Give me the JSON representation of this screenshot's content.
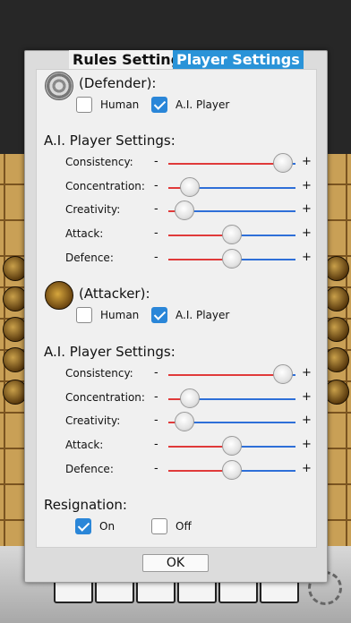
{
  "tabs": {
    "rules": "Rules Settings",
    "player": "Player Settings"
  },
  "defender": {
    "title": "(Defender):",
    "human_label": "Human",
    "ai_label": "A.I. Player",
    "human_checked": false,
    "ai_checked": true,
    "settings_title": "A.I. Player Settings:",
    "sliders": [
      {
        "label": "Consistency:",
        "value": 0.9
      },
      {
        "label": "Concentration:",
        "value": 0.17
      },
      {
        "label": "Creativity:",
        "value": 0.13
      },
      {
        "label": "Attack:",
        "value": 0.5
      },
      {
        "label": "Defence:",
        "value": 0.5
      }
    ]
  },
  "attacker": {
    "title": "(Attacker):",
    "human_label": "Human",
    "ai_label": "A.I. Player",
    "human_checked": false,
    "ai_checked": true,
    "settings_title": "A.I. Player Settings:",
    "sliders": [
      {
        "label": "Consistency:",
        "value": 0.9
      },
      {
        "label": "Concentration:",
        "value": 0.17
      },
      {
        "label": "Creativity:",
        "value": 0.13
      },
      {
        "label": "Attack:",
        "value": 0.5
      },
      {
        "label": "Defence:",
        "value": 0.5
      }
    ]
  },
  "slider_symbols": {
    "minus": "-",
    "plus": "+"
  },
  "resignation": {
    "title": "Resignation:",
    "on_label": "On",
    "off_label": "Off",
    "on_checked": true,
    "off_checked": false
  },
  "ok_label": "OK",
  "colors": {
    "accent": "#2a86d8",
    "slider_low": "#e03a3a",
    "slider_high": "#2e6fd8"
  }
}
